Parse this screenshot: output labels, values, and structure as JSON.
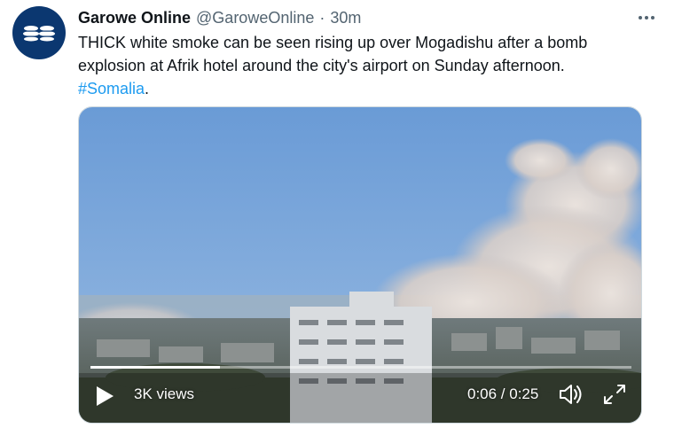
{
  "tweet": {
    "author_name": "Garowe Online",
    "handle": "@GaroweOnline",
    "separator": "·",
    "time": "30m",
    "text_line1": "THICK white smoke can be seen rising up over Mogadishu after a bomb",
    "text_line2": "explosion at Afrik hotel around the city's airport on Sunday afternoon.",
    "hashtag": "#Somalia",
    "hashtag_suffix": "."
  },
  "video": {
    "views": "3K views",
    "timecode": "0:06 / 0:25",
    "progress": 0.24
  },
  "colors": {
    "link": "#1d9bf0",
    "avatar_bg": "#0b3770",
    "sky": "#6f9fd8"
  },
  "icons": [
    "more-options-icon",
    "play-icon",
    "volume-icon",
    "fullscreen-icon",
    "garowe-logo-icon"
  ]
}
